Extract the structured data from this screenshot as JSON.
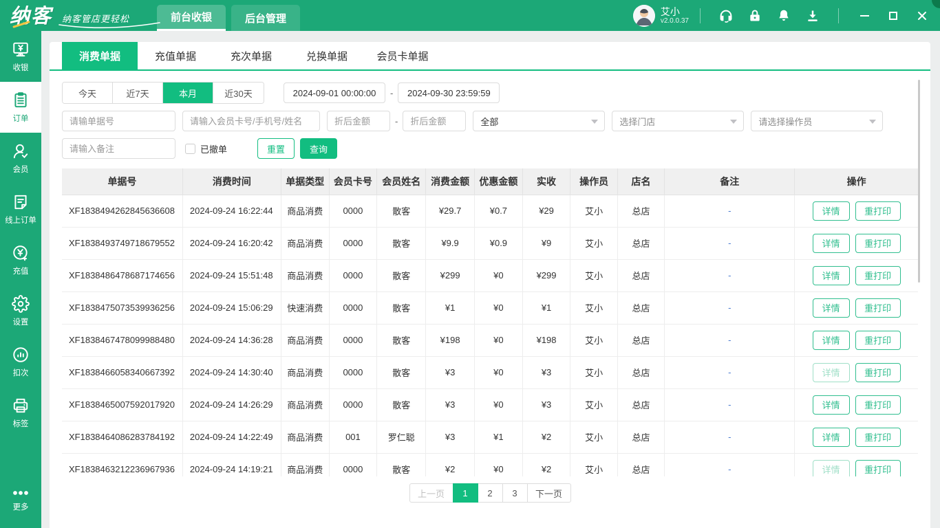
{
  "colors": {
    "header_green": "#1CA877",
    "accent_green": "#12BD80",
    "remark_link_blue": "#4a7bd0",
    "visited_button_green": "#9fdfc7"
  },
  "header": {
    "logo": "纳客",
    "slogan": "纳客管店更轻松",
    "nav": [
      {
        "label": "前台收银",
        "active": true
      },
      {
        "label": "后台管理",
        "active": false
      }
    ],
    "user": {
      "name": "艾小",
      "version": "v2.0.0.37"
    },
    "icons": [
      "customer-service",
      "lock",
      "bell",
      "download"
    ],
    "window_controls": [
      "minimize",
      "maximize",
      "close"
    ]
  },
  "sidebar": {
    "items": [
      {
        "label": "收银",
        "icon": "cash-register",
        "active": false
      },
      {
        "label": "订单",
        "icon": "order-list",
        "active": true
      },
      {
        "label": "会员",
        "icon": "member",
        "active": false
      },
      {
        "label": "线上订单",
        "icon": "online-order",
        "active": false
      },
      {
        "label": "充值",
        "icon": "recharge",
        "active": false
      },
      {
        "label": "设置",
        "icon": "settings-gear",
        "active": false
      },
      {
        "label": "扣次",
        "icon": "deduct-count",
        "active": false
      },
      {
        "label": "标签",
        "icon": "label-printer",
        "active": false
      },
      {
        "label": "更多",
        "icon": "more-dots",
        "active": false
      }
    ]
  },
  "tabs": [
    {
      "label": "消费单据",
      "active": true
    },
    {
      "label": "充值单据",
      "active": false
    },
    {
      "label": "充次单据",
      "active": false
    },
    {
      "label": "兑换单据",
      "active": false
    },
    {
      "label": "会员卡单据",
      "active": false
    }
  ],
  "filters": {
    "quick_ranges": [
      {
        "label": "今天",
        "active": false
      },
      {
        "label": "近7天",
        "active": false
      },
      {
        "label": "本月",
        "active": true
      },
      {
        "label": "近30天",
        "active": false
      }
    ],
    "date_from": "2024-09-01 00:00:00",
    "date_to": "2024-09-30 23:59:59",
    "range_dash": "-",
    "order_no_placeholder": "请输单据号",
    "member_placeholder": "请输入会员卡号/手机号/姓名",
    "amount_min_placeholder": "折后金额",
    "amount_max_placeholder": "折后金额",
    "amount_dash": "-",
    "type_select_value": "全部",
    "store_select_placeholder": "选择门店",
    "operator_select_placeholder": "请选择操作员",
    "remark_placeholder": "请输入备注",
    "revoked_checkbox_label": "已撤单",
    "reset_label": "重置",
    "search_label": "查询"
  },
  "table": {
    "columns": [
      "单据号",
      "消费时间",
      "单据类型",
      "会员卡号",
      "会员姓名",
      "消费金额",
      "优惠金额",
      "实收",
      "操作员",
      "店名",
      "备注",
      "操作"
    ],
    "detail_label": "详情",
    "reprint_label": "重打印",
    "rows": [
      {
        "order_no": "XF1838494262845636608",
        "time": "2024-09-24 16:22:44",
        "type": "商品消费",
        "card_no": "0000",
        "member": "散客",
        "amount": "¥29.7",
        "discount": "¥0.7",
        "paid": "¥29",
        "operator": "艾小",
        "store": "总店",
        "remark": "-",
        "detail_visited": false
      },
      {
        "order_no": "XF1838493749718679552",
        "time": "2024-09-24 16:20:42",
        "type": "商品消费",
        "card_no": "0000",
        "member": "散客",
        "amount": "¥9.9",
        "discount": "¥0.9",
        "paid": "¥9",
        "operator": "艾小",
        "store": "总店",
        "remark": "-",
        "detail_visited": false
      },
      {
        "order_no": "XF1838486478687174656",
        "time": "2024-09-24 15:51:48",
        "type": "商品消费",
        "card_no": "0000",
        "member": "散客",
        "amount": "¥299",
        "discount": "¥0",
        "paid": "¥299",
        "operator": "艾小",
        "store": "总店",
        "remark": "-",
        "detail_visited": false
      },
      {
        "order_no": "XF1838475073539936256",
        "time": "2024-09-24 15:06:29",
        "type": "快速消费",
        "card_no": "0000",
        "member": "散客",
        "amount": "¥1",
        "discount": "¥0",
        "paid": "¥1",
        "operator": "艾小",
        "store": "总店",
        "remark": "-",
        "detail_visited": false
      },
      {
        "order_no": "XF1838467478099988480",
        "time": "2024-09-24 14:36:28",
        "type": "商品消费",
        "card_no": "0000",
        "member": "散客",
        "amount": "¥198",
        "discount": "¥0",
        "paid": "¥198",
        "operator": "艾小",
        "store": "总店",
        "remark": "-",
        "detail_visited": false
      },
      {
        "order_no": "XF1838466058340667392",
        "time": "2024-09-24 14:30:40",
        "type": "商品消费",
        "card_no": "0000",
        "member": "散客",
        "amount": "¥3",
        "discount": "¥0",
        "paid": "¥3",
        "operator": "艾小",
        "store": "总店",
        "remark": "-",
        "detail_visited": true
      },
      {
        "order_no": "XF1838465007592017920",
        "time": "2024-09-24 14:26:29",
        "type": "商品消费",
        "card_no": "0000",
        "member": "散客",
        "amount": "¥3",
        "discount": "¥0",
        "paid": "¥3",
        "operator": "艾小",
        "store": "总店",
        "remark": "-",
        "detail_visited": false
      },
      {
        "order_no": "XF1838464086283784192",
        "time": "2024-09-24 14:22:49",
        "type": "商品消费",
        "card_no": "001",
        "member": "罗仁聪",
        "amount": "¥3",
        "discount": "¥1",
        "paid": "¥2",
        "operator": "艾小",
        "store": "总店",
        "remark": "-",
        "detail_visited": false
      },
      {
        "order_no": "XF1838463212236967936",
        "time": "2024-09-24 14:19:21",
        "type": "商品消费",
        "card_no": "0000",
        "member": "散客",
        "amount": "¥2",
        "discount": "¥0",
        "paid": "¥2",
        "operator": "艾小",
        "store": "总店",
        "remark": "-",
        "detail_visited": true
      }
    ]
  },
  "pagination": {
    "prev_label": "上一页",
    "pages": [
      "1",
      "2",
      "3"
    ],
    "active_page": "1",
    "next_label": "下一页"
  }
}
